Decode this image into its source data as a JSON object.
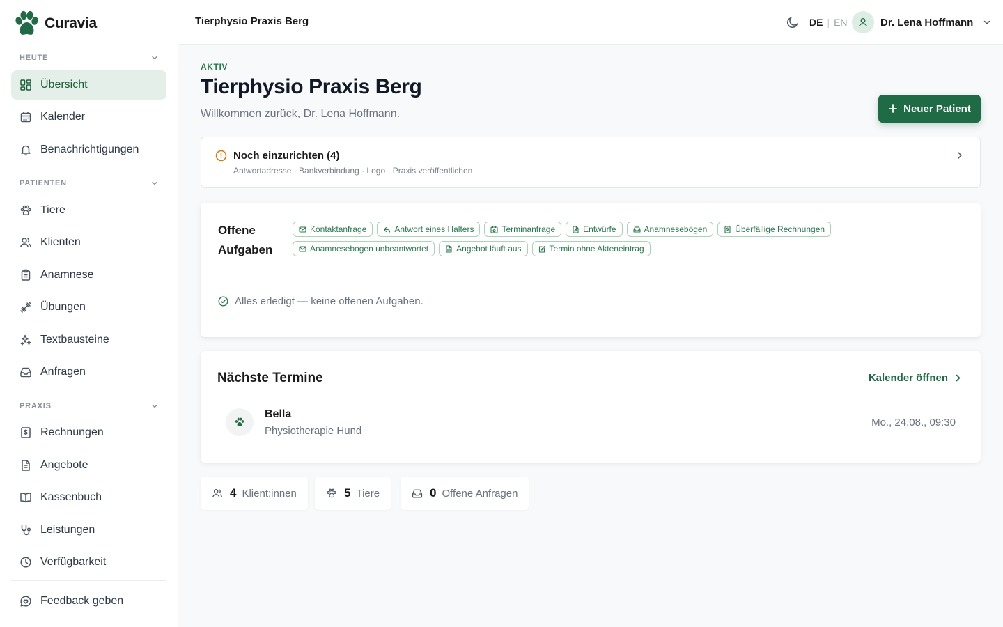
{
  "brand": {
    "name": "Curavia"
  },
  "sidebar": {
    "sections": [
      {
        "label": "HEUTE"
      },
      {
        "label": "PATIENTEN"
      },
      {
        "label": "PRAXIS"
      }
    ],
    "items": [
      {
        "label": "Übersicht",
        "icon": "dashboard-icon",
        "active": true
      },
      {
        "label": "Kalender",
        "icon": "calendar-icon"
      },
      {
        "label": "Benachrichtigungen",
        "icon": "bell-icon"
      },
      {
        "label": "Tiere",
        "icon": "paw-icon"
      },
      {
        "label": "Klienten",
        "icon": "users-icon"
      },
      {
        "label": "Anamnese",
        "icon": "clipboard-icon"
      },
      {
        "label": "Übungen",
        "icon": "dumbbell-icon"
      },
      {
        "label": "Textbausteine",
        "icon": "sparkles-icon"
      },
      {
        "label": "Anfragen",
        "icon": "inbox-icon"
      },
      {
        "label": "Rechnungen",
        "icon": "receipt-icon"
      },
      {
        "label": "Angebote",
        "icon": "document-icon"
      },
      {
        "label": "Kassenbuch",
        "icon": "book-icon"
      },
      {
        "label": "Leistungen",
        "icon": "stethoscope-icon"
      },
      {
        "label": "Verfügbarkeit",
        "icon": "clock-icon"
      }
    ],
    "feedback": {
      "label": "Feedback geben",
      "icon": "feedback-icon"
    }
  },
  "topbar": {
    "title": "Tierphysio Praxis Berg",
    "lang_de": "DE",
    "lang_sep": "|",
    "lang_en": "EN",
    "user_name": "Dr. Lena Hoffmann"
  },
  "header": {
    "status": "AKTIV",
    "title": "Tierphysio Praxis Berg",
    "welcome": "Willkommen zurück, Dr. Lena Hoffmann.",
    "new_patient_label": "Neuer Patient"
  },
  "setup": {
    "title": "Noch einzurichten (4)",
    "subtitle": "Antwortadresse · Bankverbindung · Logo · Praxis veröffentlichen"
  },
  "tasks": {
    "title_line1": "Offene",
    "title_line2": "Aufgaben",
    "chips": [
      {
        "label": "Kontaktanfrage",
        "icon": "mail-icon"
      },
      {
        "label": "Antwort eines Halters",
        "icon": "reply-icon"
      },
      {
        "label": "Terminanfrage",
        "icon": "calendar-clock-icon"
      },
      {
        "label": "Entwürfe",
        "icon": "file-edit-icon"
      },
      {
        "label": "Anamnesebögen",
        "icon": "inbox-icon"
      },
      {
        "label": "Überfällige Rechnungen",
        "icon": "receipt-icon"
      },
      {
        "label": "Anamnesebogen unbeantwortet",
        "icon": "mail-icon"
      },
      {
        "label": "Angebot läuft aus",
        "icon": "file-clock-icon"
      },
      {
        "label": "Termin ohne Akteneintrag",
        "icon": "note-edit-icon"
      }
    ],
    "empty_text": "Alles erledigt — keine offenen Aufgaben."
  },
  "appointments": {
    "title": "Nächste Termine",
    "calendar_link": "Kalender öffnen",
    "rows": [
      {
        "name": "Bella",
        "type": "Physiotherapie Hund",
        "time": "Mo., 24.08., 09:30"
      }
    ]
  },
  "stats": [
    {
      "value": "4",
      "label": "Klient:innen",
      "icon": "users-icon"
    },
    {
      "value": "5",
      "label": "Tiere",
      "icon": "paw-icon"
    },
    {
      "value": "0",
      "label": "Offene Anfragen",
      "icon": "inbox-icon"
    }
  ],
  "colors": {
    "accent": "#1f6b45",
    "accent_light": "#e3efe8",
    "warning": "#d97706"
  }
}
